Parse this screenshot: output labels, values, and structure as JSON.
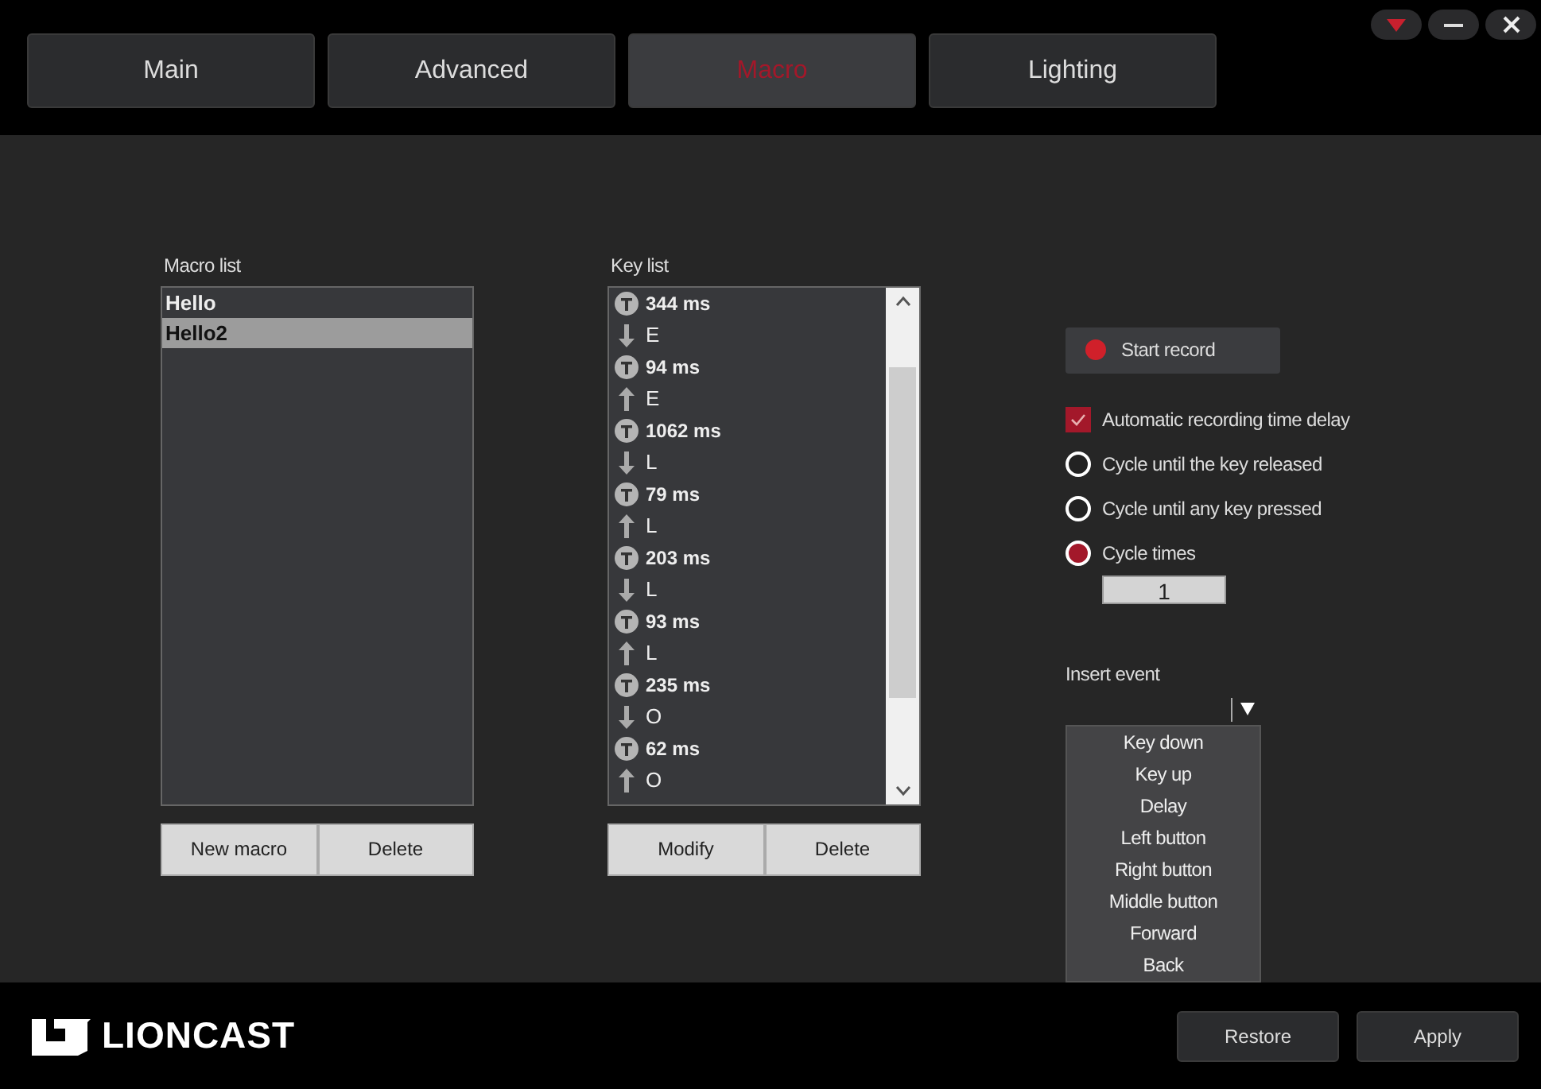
{
  "window_controls": [
    {
      "kind": "menu"
    },
    {
      "kind": "minimize"
    },
    {
      "kind": "close"
    }
  ],
  "tabs": [
    {
      "label": "Main",
      "selected": false
    },
    {
      "label": "Advanced",
      "selected": false
    },
    {
      "label": "Macro",
      "selected": true
    },
    {
      "label": "Lighting",
      "selected": false
    }
  ],
  "macro_list": {
    "label": "Macro list",
    "items": [
      {
        "name": "Hello",
        "selected": false
      },
      {
        "name": "Hello2",
        "selected": true
      }
    ],
    "buttons": [
      "New macro",
      "Delete"
    ]
  },
  "key_list": {
    "label": "Key list",
    "items": [
      {
        "kind": "delay",
        "text": "344 ms"
      },
      {
        "kind": "down",
        "text": "E"
      },
      {
        "kind": "delay",
        "text": "94 ms"
      },
      {
        "kind": "up",
        "text": "E"
      },
      {
        "kind": "delay",
        "text": "1062 ms"
      },
      {
        "kind": "down",
        "text": "L"
      },
      {
        "kind": "delay",
        "text": "79 ms"
      },
      {
        "kind": "up",
        "text": "L"
      },
      {
        "kind": "delay",
        "text": "203 ms"
      },
      {
        "kind": "down",
        "text": "L"
      },
      {
        "kind": "delay",
        "text": "93 ms"
      },
      {
        "kind": "up",
        "text": "L"
      },
      {
        "kind": "delay",
        "text": "235 ms"
      },
      {
        "kind": "down",
        "text": "O"
      },
      {
        "kind": "delay",
        "text": "62 ms"
      },
      {
        "kind": "up",
        "text": "O"
      }
    ],
    "buttons": [
      "Modify",
      "Delete"
    ]
  },
  "record_button": "Start record",
  "options": [
    {
      "kind": "checkbox",
      "label": "Automatic recording time delay",
      "checked": true
    },
    {
      "kind": "radio",
      "label": "Cycle until the key released",
      "selected": false
    },
    {
      "kind": "radio",
      "label": "Cycle until any key pressed",
      "selected": false
    },
    {
      "kind": "radio",
      "label": "Cycle times",
      "selected": true
    }
  ],
  "cycle_times": "1",
  "insert_event": {
    "label": "Insert event",
    "expanded": true,
    "options": [
      "Key down",
      "Key up",
      "Delay",
      "Left button",
      "Right button",
      "Middle button",
      "Forward",
      "Back"
    ]
  },
  "logo": "LIONCAST",
  "footer_buttons": [
    "Restore",
    "Apply"
  ]
}
